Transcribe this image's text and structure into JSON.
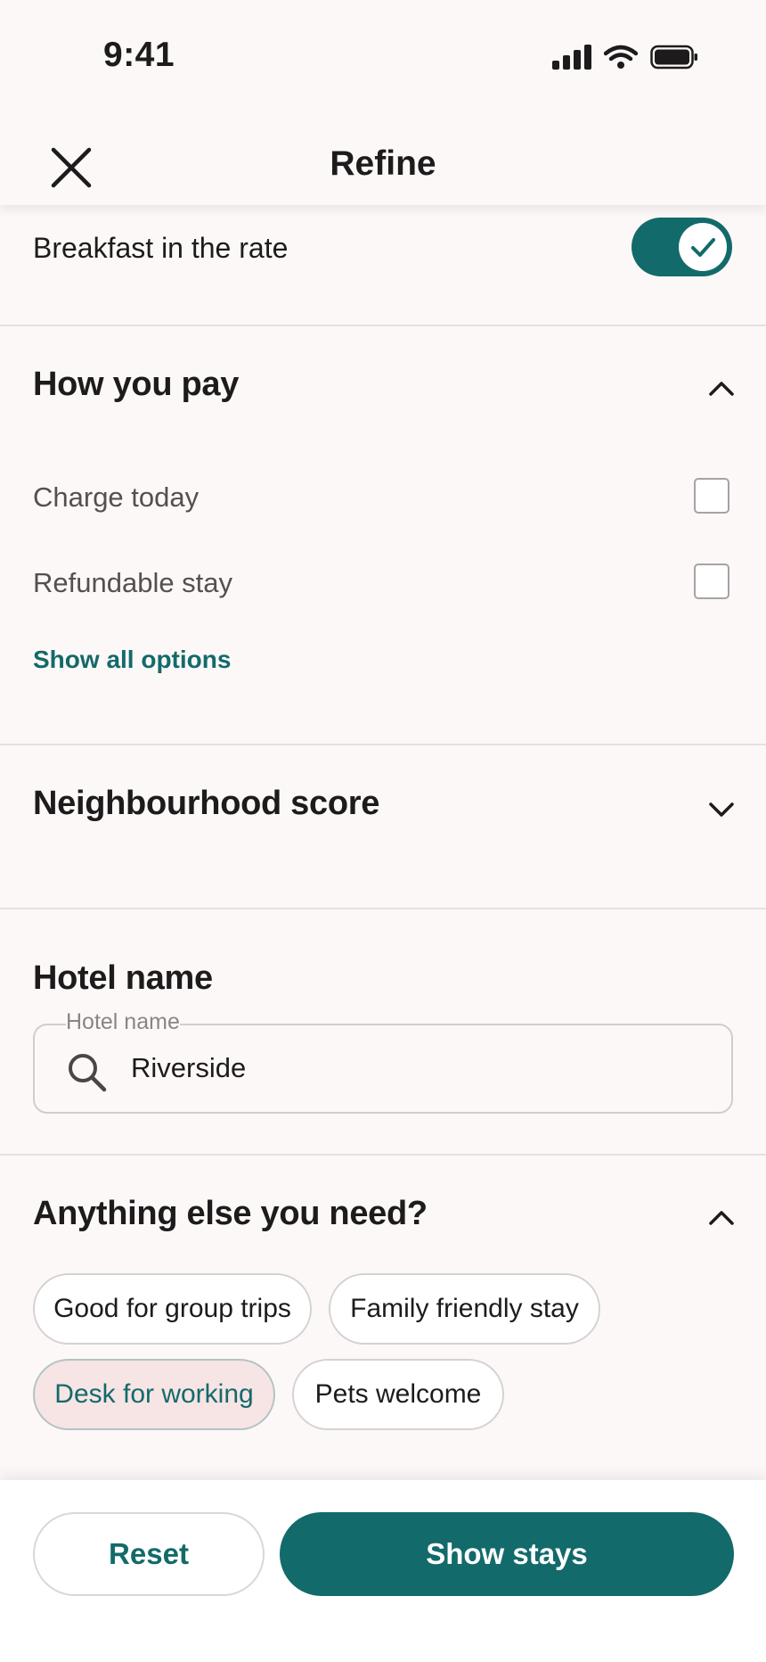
{
  "status_bar": {
    "time": "9:41"
  },
  "header": {
    "title": "Refine",
    "close_icon": "close-icon"
  },
  "breakfast": {
    "label": "Breakfast in the rate",
    "enabled": true
  },
  "how_you_pay": {
    "title": "How you pay",
    "expanded": true,
    "options": [
      {
        "label": "Charge today",
        "checked": false
      },
      {
        "label": "Refundable stay",
        "checked": false
      }
    ],
    "show_all_label": "Show all options"
  },
  "neighbourhood": {
    "title": "Neighbourhood score",
    "expanded": false
  },
  "hotel_name": {
    "title": "Hotel name",
    "floating_label": "Hotel name",
    "value": "Riverside"
  },
  "anything_else": {
    "title": "Anything else you need?",
    "expanded": true,
    "chips": [
      {
        "label": "Good for group trips",
        "selected": false
      },
      {
        "label": "Family friendly stay",
        "selected": false
      },
      {
        "label": "Desk for working",
        "selected": true
      },
      {
        "label": "Pets welcome",
        "selected": false
      }
    ]
  },
  "footer": {
    "reset_label": "Reset",
    "show_label": "Show stays"
  },
  "colors": {
    "accent": "#136a6a",
    "background": "#fdf8f8",
    "chip_selected_bg": "#f7e4e4"
  }
}
